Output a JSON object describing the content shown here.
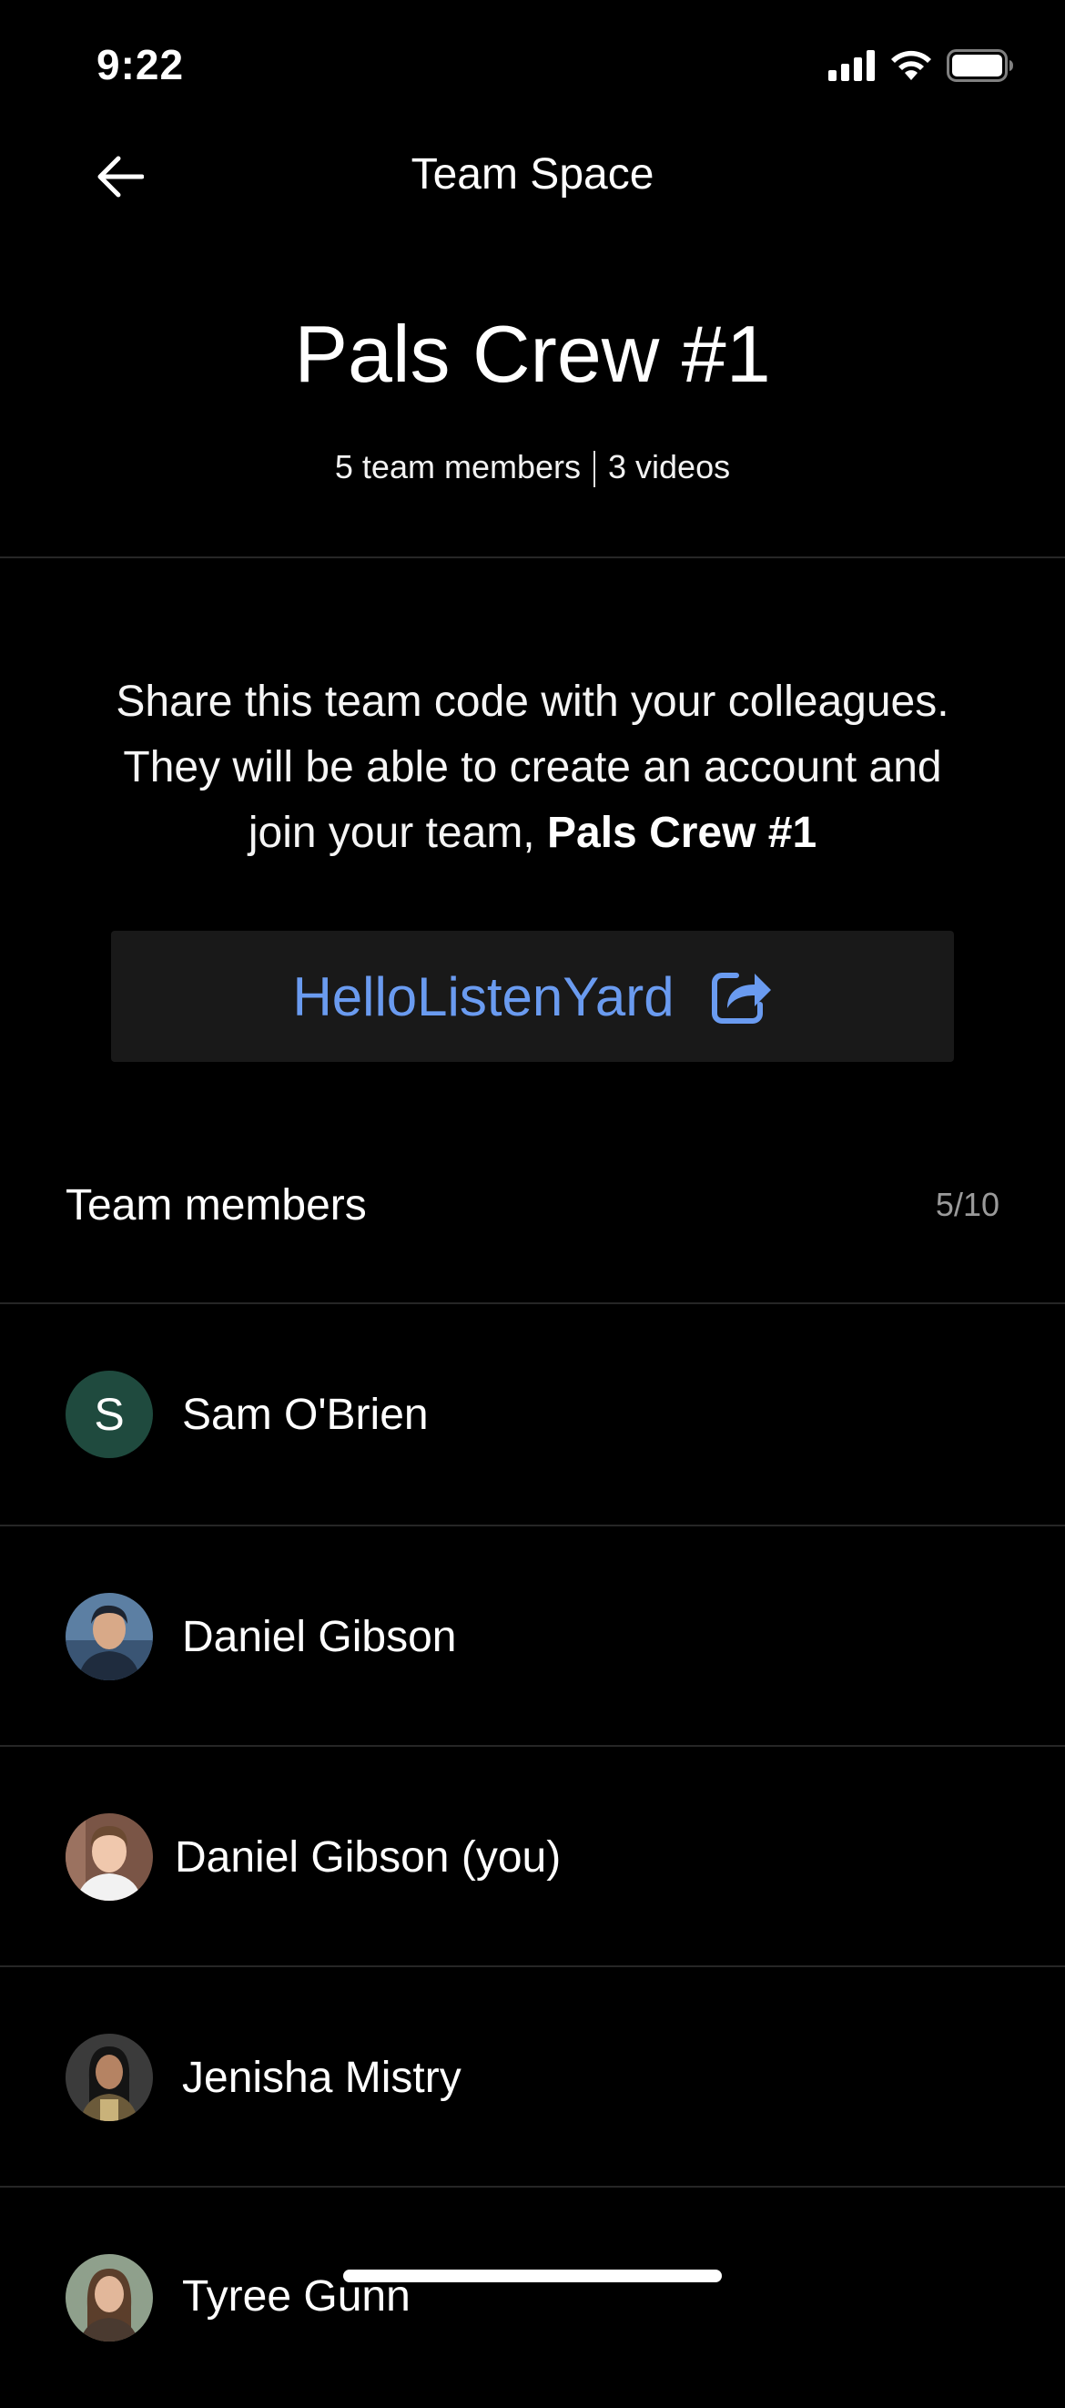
{
  "status_bar": {
    "time": "9:22",
    "icons": [
      "cellular-signal-icon",
      "wifi-icon",
      "battery-icon"
    ]
  },
  "nav": {
    "title": "Team Space",
    "back_icon": "arrow-left-icon"
  },
  "team": {
    "name": "Pals Crew #1",
    "members_text": "5 team members",
    "videos_text": "3 videos"
  },
  "share": {
    "line1": "Share this team code with your colleagues.",
    "line2": "They will be able to create an account and",
    "line3_prefix": "join your team, ",
    "line3_team": "Pals Crew #1",
    "code": "HelloListenYard",
    "share_icon": "share-icon",
    "code_color": "#6a9bf0"
  },
  "members_section": {
    "title": "Team members",
    "count": "5/10"
  },
  "members": [
    {
      "name": "Sam O'Brien",
      "avatar_letter": "S",
      "avatar_color": "#1f4a3e"
    },
    {
      "name": "Daniel Gibson"
    },
    {
      "name": "Daniel Gibson (you)"
    },
    {
      "name": "Jenisha Mistry"
    },
    {
      "name": "Tyree Gunn"
    }
  ]
}
